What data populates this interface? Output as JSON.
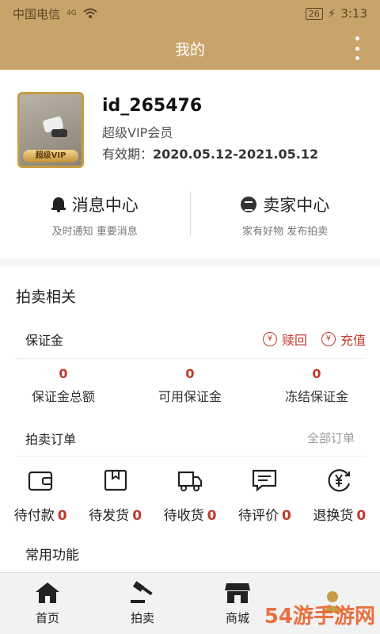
{
  "status_bar": {
    "carrier": "中国电信",
    "network": "4G",
    "battery": "26",
    "time": "3:13"
  },
  "header": {
    "title": "我的"
  },
  "profile": {
    "vip_badge": "超级VIP",
    "user_id": "id_265476",
    "vip_level": "超级VIP会员",
    "validity_label": "有效期：",
    "validity_range": "2020.05.12-2021.05.12"
  },
  "centers": [
    {
      "title": "消息中心",
      "subtitle": "及时通知 重要消息",
      "icon": "bell-icon"
    },
    {
      "title": "卖家中心",
      "subtitle": "家有好物 发布拍卖",
      "icon": "coin-icon"
    }
  ],
  "auction": {
    "section_title": "拍卖相关",
    "deposit": {
      "label": "保证金",
      "redeem": "赎回",
      "recharge": "充值"
    },
    "stats": [
      {
        "value": "0",
        "label": "保证金总额"
      },
      {
        "value": "0",
        "label": "可用保证金"
      },
      {
        "value": "0",
        "label": "冻结保证金"
      }
    ],
    "orders": {
      "label": "拍卖订单",
      "all": "全部订单"
    },
    "order_items": [
      {
        "label": "待付款",
        "count": "0",
        "icon": "wallet-icon"
      },
      {
        "label": "待发货",
        "count": "0",
        "icon": "box-icon"
      },
      {
        "label": "待收货",
        "count": "0",
        "icon": "truck-icon"
      },
      {
        "label": "待评价",
        "count": "0",
        "icon": "comment-icon"
      },
      {
        "label": "退换货",
        "count": "0",
        "icon": "refund-icon"
      }
    ],
    "common_title": "常用功能"
  },
  "tabs": [
    {
      "label": "首页",
      "icon": "home-icon"
    },
    {
      "label": "拍卖",
      "icon": "gavel-icon"
    },
    {
      "label": "商城",
      "icon": "shop-icon"
    },
    {
      "label": "",
      "icon": "profile-icon"
    }
  ],
  "watermark": "54游手游网",
  "colors": {
    "header": "#c9a46a",
    "accent_red": "#c0392b",
    "gold": "#c89c46"
  }
}
